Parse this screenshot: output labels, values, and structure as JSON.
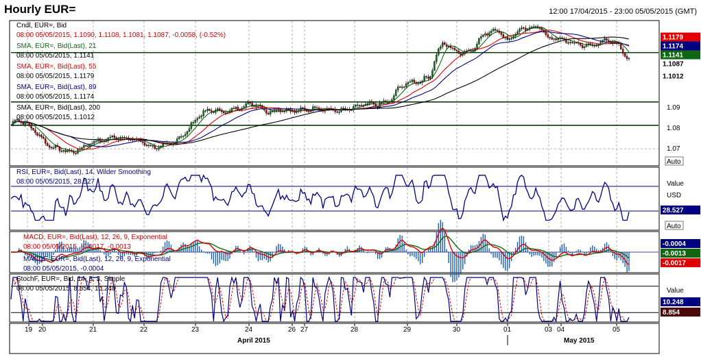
{
  "header": {
    "title": "Hourly EUR=",
    "range": "12:00 17/04/2015 - 23:00 05/05/2015 (GMT)"
  },
  "colors": {
    "candle_up": "#1a7a1a",
    "candle_down": "#cc0000",
    "sma21": "#116611",
    "sma55": "#dd0000",
    "sma89": "#000080",
    "sma200": "#000000",
    "rsi": "#000080",
    "macd": "#dd0000",
    "macdf": "#116611",
    "hist": "#1a5fb4",
    "stoch_k": "#000080",
    "stoch_d": "#dd0000"
  },
  "price_panel": {
    "legend": [
      {
        "line1": "Cndl, EUR=, Bid",
        "line2": "08:00 05/05/2015, 1.1090, 1.1108, 1.1081, 1.1087, -0.0058, (-0.52%)",
        "color": "#000000",
        "color2": "#cc0000"
      },
      {
        "line1": "SMA, EUR=, Bid(Last), 21",
        "line2": "08:00 05/05/2015, 1.1141",
        "color": "#116611",
        "color2": "#000000"
      },
      {
        "line1": "SMA, EUR=, Bid(Last), 55",
        "line2": "08:00 05/05/2015, 1.1179",
        "color": "#dd0000",
        "color2": "#000000"
      },
      {
        "line1": "SMA, EUR=, Bid(Last), 89",
        "line2": "08:00 05/05/2015, 1.1174",
        "color": "#000080",
        "color2": "#000000"
      },
      {
        "line1": "SMA, EUR=, Bid(Last), 200",
        "line2": "08:00 05/05/2015, 1.1012",
        "color": "#000000",
        "color2": "#000000"
      }
    ],
    "y_ticks": [
      "1.09",
      "1.08",
      "1.07"
    ],
    "y_tick_values": [
      1.09,
      1.08,
      1.07
    ],
    "y_range": [
      1.063,
      1.1245
    ],
    "price_tags": [
      {
        "text": "1.1179",
        "value": 1.1179,
        "bg": "#e00000",
        "fg": "#ffffff"
      },
      {
        "text": "1.1174",
        "value": 1.1174,
        "bg": "#000080",
        "fg": "#ffffff"
      },
      {
        "text": "1.1141",
        "value": 1.1141,
        "bg": "#116611",
        "fg": "#ffffff"
      },
      {
        "text": "1.1087",
        "value": 1.1087,
        "bg": "#ffffff",
        "fg": "#000000"
      },
      {
        "text": "1.1012",
        "value": 1.1012,
        "bg": "#ffffff",
        "fg": "#000000"
      }
    ],
    "horizontal_lines": [
      1.1111,
      1.09,
      1.08
    ],
    "auto_label": "Auto"
  },
  "rsi_panel": {
    "legend_line1": "RSI, EUR=, Bid(Last), 14, Wilder Smoothing",
    "legend_line2": "08:00 05/05/2015, 28.527",
    "value_label": "Value",
    "unit_label": "USD",
    "tag": "28.527",
    "auto_label": "Auto",
    "levels": [
      70,
      30
    ]
  },
  "macd_panel": {
    "legend1_line1": "MACD, EUR=, Bid(Last), 12, 26, 9, Exponential",
    "legend1_line2": "08:00 05/05/2015, -0.0017, -0.0013",
    "legend2_line1": "MACDF, EUR=, Bid(Last), 12, 26, 9, Exponential",
    "legend2_line2": "08:00 05/05/2015, -0.0004",
    "tags": [
      {
        "text": "-0.0004",
        "bg": "#000080",
        "fg": "#ffffff"
      },
      {
        "text": "-0.0013",
        "bg": "#116611",
        "fg": "#ffffff"
      },
      {
        "text": "-0.0017",
        "bg": "#e00000",
        "fg": "#ffffff"
      }
    ]
  },
  "stoch_panel": {
    "legend_line1": "StochF, EUR=, Bid, 14, 3, 3, Simple",
    "legend_line2": "08:00 05/05/2015, 8.854, 10.248",
    "value_label": "Value",
    "tags": [
      {
        "text": "10.248",
        "bg": "#000080",
        "fg": "#ffffff"
      },
      {
        "text": "8.854",
        "bg": "#4a0a0a",
        "fg": "#ffffff"
      }
    ],
    "levels": [
      80,
      20
    ]
  },
  "x_axis": {
    "day_labels": [
      "19",
      "20",
      "21",
      "22",
      "23",
      "24",
      "26",
      "27",
      "28",
      "29",
      "30",
      "01",
      "03",
      "04",
      "05"
    ],
    "month_labels": [
      "April 2015",
      "May 2015"
    ]
  },
  "chart_data": {
    "type": "candlestick",
    "instrument": "EUR=",
    "interval": "Hourly",
    "ylim": [
      1.063,
      1.1245
    ],
    "anchor_closes": [
      [
        0,
        1.08
      ],
      [
        8,
        1.082
      ],
      [
        22,
        1.0795
      ],
      [
        40,
        1.076
      ],
      [
        55,
        1.0725
      ],
      [
        75,
        1.0705
      ],
      [
        90,
        1.068
      ],
      [
        105,
        1.069
      ],
      [
        120,
        1.072
      ],
      [
        135,
        1.074
      ],
      [
        150,
        1.076
      ],
      [
        160,
        1.076
      ],
      [
        175,
        1.074
      ],
      [
        190,
        1.072
      ],
      [
        210,
        1.07
      ],
      [
        230,
        1.0725
      ],
      [
        260,
        1.077
      ],
      [
        280,
        1.0835
      ],
      [
        300,
        1.0865
      ],
      [
        320,
        1.087
      ],
      [
        340,
        1.0885
      ],
      [
        360,
        1.088
      ],
      [
        380,
        1.085
      ],
      [
        400,
        1.088
      ],
      [
        420,
        1.087
      ],
      [
        440,
        1.086
      ],
      [
        470,
        1.0865
      ],
      [
        500,
        1.088
      ],
      [
        520,
        1.0885
      ],
      [
        540,
        1.0875
      ],
      [
        560,
        1.09
      ],
      [
        575,
        1.0975
      ],
      [
        590,
        1.0995
      ],
      [
        605,
        1.0985
      ],
      [
        620,
        1.0995
      ],
      [
        630,
        1.109
      ],
      [
        640,
        1.115
      ],
      [
        655,
        1.113
      ],
      [
        670,
        1.112
      ],
      [
        685,
        1.1135
      ],
      [
        700,
        1.118
      ],
      [
        720,
        1.12
      ],
      [
        735,
        1.1165
      ],
      [
        750,
        1.1215
      ],
      [
        770,
        1.1225
      ],
      [
        785,
        1.121
      ],
      [
        795,
        1.116
      ],
      [
        820,
        1.1165
      ],
      [
        840,
        1.116
      ],
      [
        860,
        1.114
      ],
      [
        880,
        1.115
      ],
      [
        900,
        1.114
      ],
      [
        915,
        1.1087
      ]
    ],
    "last_candle": {
      "open": 1.109,
      "high": 1.1108,
      "low": 1.1081,
      "close": 1.1087
    },
    "sma": [
      {
        "period": 21,
        "last": 1.1141
      },
      {
        "period": 55,
        "last": 1.1179
      },
      {
        "period": 89,
        "last": 1.1174
      },
      {
        "period": 200,
        "last": 1.1012
      }
    ],
    "rsi_last": 28.527,
    "macd_last": [
      -0.0017,
      -0.0013
    ],
    "macdf_last": -0.0004,
    "stoch_last": [
      8.854,
      10.248
    ]
  }
}
